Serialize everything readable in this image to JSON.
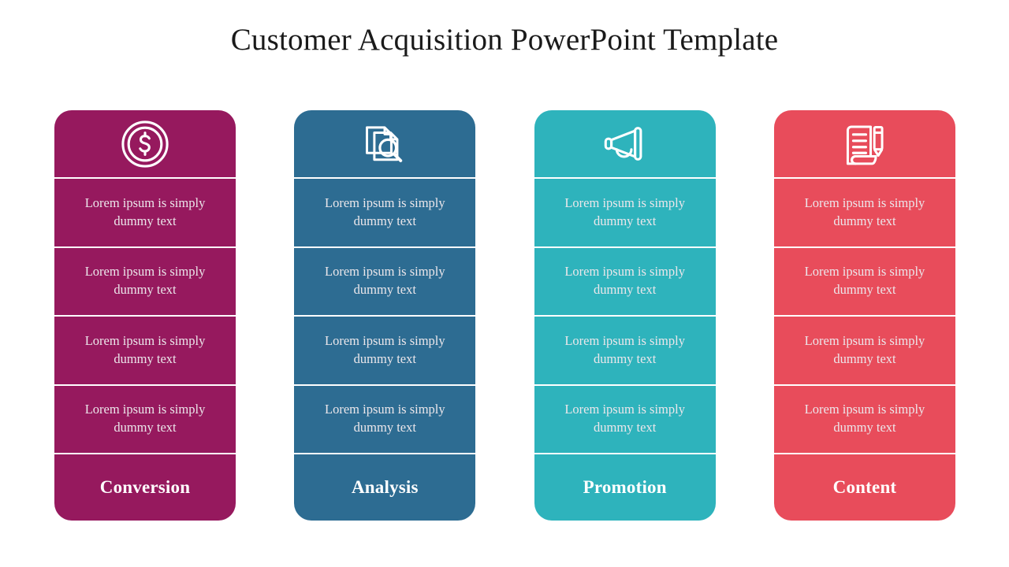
{
  "slide": {
    "title": "Customer Acquisition PowerPoint Template",
    "background_color": "#ffffff",
    "title_color": "#1a1a1a"
  },
  "columns": [
    {
      "id": "conversion",
      "icon": "dollar-coin-icon",
      "color": "#96195e",
      "footer_label": "Conversion",
      "rows": [
        "Lorem ipsum is simply dummy text",
        "Lorem ipsum is simply dummy text",
        "Lorem ipsum is simply dummy text",
        "Lorem ipsum is simply dummy text"
      ]
    },
    {
      "id": "analysis",
      "icon": "document-search-icon",
      "color": "#2d6c92",
      "footer_label": "Analysis",
      "rows": [
        "Lorem ipsum is simply dummy text",
        "Lorem ipsum is simply dummy text",
        "Lorem ipsum is simply dummy text",
        "Lorem ipsum is simply dummy text"
      ]
    },
    {
      "id": "promotion",
      "icon": "megaphone-icon",
      "color": "#2eb3bc",
      "footer_label": "Promotion",
      "rows": [
        "Lorem ipsum is simply dummy text",
        "Lorem ipsum is simply dummy text",
        "Lorem ipsum is simply dummy text",
        "Lorem ipsum is simply dummy text"
      ]
    },
    {
      "id": "content",
      "icon": "document-pencil-icon",
      "color": "#e84c5b",
      "footer_label": "Content",
      "rows": [
        "Lorem ipsum is simply dummy text",
        "Lorem ipsum is simply dummy text",
        "Lorem ipsum is simply dummy text",
        "Lorem ipsum is simply dummy text"
      ]
    }
  ]
}
